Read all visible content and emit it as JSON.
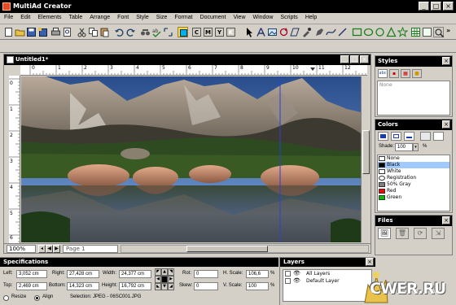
{
  "app": {
    "title": "MultiAd Creator"
  },
  "window_buttons": {
    "minimize": "_",
    "maximize": "□",
    "close": "×"
  },
  "menu": [
    "File",
    "Edit",
    "Elements",
    "Table",
    "Arrange",
    "Font",
    "Style",
    "Size",
    "Format",
    "Document",
    "View",
    "Window",
    "Scripts",
    "Help"
  ],
  "toolbar": {
    "color_buttons": [
      {
        "label": "C",
        "color": "#00e5ff"
      },
      {
        "label": "M",
        "color": "#ff33cc"
      },
      {
        "label": "Y",
        "color": "#ffee00"
      },
      {
        "label": "K",
        "color": "#222222"
      }
    ],
    "overflow": "»"
  },
  "document": {
    "title": "Untitled1*",
    "ruler_h": [
      "0",
      "1",
      "2",
      "3",
      "4",
      "5",
      "6",
      "7",
      "8",
      "9",
      "10",
      "11",
      "12"
    ],
    "ruler_v": [
      "0",
      "1",
      "2",
      "3",
      "4",
      "5",
      "6"
    ],
    "zoom": "100%",
    "page": "Page 1"
  },
  "styles_palette": {
    "title": "Styles",
    "close": "×",
    "list_item": "None"
  },
  "colors_palette": {
    "title": "Colors",
    "close": "×",
    "shade_label": "Shade:",
    "shade_value": "100",
    "shade_unit": "%",
    "items": [
      {
        "name": "None",
        "color": "#ffffff",
        "selected": false
      },
      {
        "name": "Black",
        "color": "#000000",
        "selected": true
      },
      {
        "name": "White",
        "color": "#ffffff",
        "selected": false
      },
      {
        "name": "Registration",
        "color": "#000000",
        "selected": false
      },
      {
        "name": "50% Gray",
        "color": "#808080",
        "selected": false
      },
      {
        "name": "Red",
        "color": "#ff0000",
        "selected": false
      },
      {
        "name": "Green",
        "color": "#00c000",
        "selected": false
      }
    ]
  },
  "files_palette": {
    "title": "Files",
    "close": "×"
  },
  "specifications": {
    "title": "Specifications",
    "left_label": "Left:",
    "left_value": "3,052 cm",
    "top_label": "Top:",
    "top_value": "2,469 cm",
    "right_label": "Right:",
    "right_value": "27,428 cm",
    "bottom_label": "Bottom:",
    "bottom_value": "14,323 cm",
    "width_label": "Width:",
    "width_value": "24,377 cm",
    "height_label": "Height:",
    "height_value": "16,792 cm",
    "rot_label": "Rot:",
    "rot_value": "0",
    "skew_label": "Skew:",
    "skew_value": "0",
    "hscale_label": "H. Scale:",
    "hscale_value": "106,6",
    "vscale_label": "V. Scale:",
    "vscale_value": "100",
    "percent": "%",
    "resize_label": "Resize",
    "align_label": "Align",
    "selection_text": "Selection: JPEG - 06SC001.JPG"
  },
  "layers": {
    "title": "Layers",
    "close": "×",
    "items": [
      "All Layers",
      "Default Layer"
    ]
  },
  "watermark": {
    "text": "CWER.RU"
  }
}
